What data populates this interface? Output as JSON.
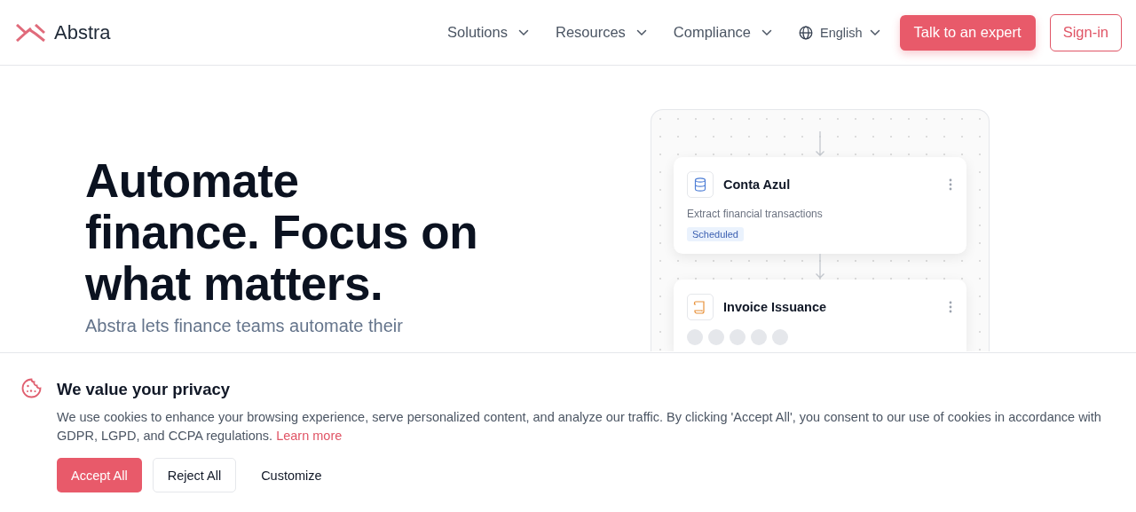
{
  "header": {
    "logo": "Abstra",
    "nav": [
      {
        "label": "Solutions"
      },
      {
        "label": "Resources"
      },
      {
        "label": "Compliance"
      }
    ],
    "language": "English",
    "cta": "Talk to an expert",
    "signin": "Sign-in"
  },
  "hero": {
    "title_lines": [
      "Automate",
      "finance. Focus on",
      "what matters."
    ],
    "subtitle": "Abstra lets finance teams automate their"
  },
  "flow": {
    "steps": [
      {
        "kind": "source",
        "title": "Conta Azul",
        "description": "Extract financial transactions",
        "badge": "Scheduled"
      },
      {
        "kind": "document",
        "title": "Invoice Issuance",
        "loading": true
      }
    ]
  },
  "cookie_banner": {
    "title": "We value your privacy",
    "text": "We use cookies to enhance your browsing experience, serve personalized content, and analyze our traffic. By clicking 'Accept All', you consent to our use of cookies in accordance with GDPR, LGPD, and CCPA regulations.",
    "link": "Learn more",
    "buttons": [
      {
        "kind": "primary",
        "label": "Accept All"
      },
      {
        "kind": "secondary",
        "label": "Reject All"
      },
      {
        "kind": "plain",
        "label": "Customize"
      }
    ]
  }
}
